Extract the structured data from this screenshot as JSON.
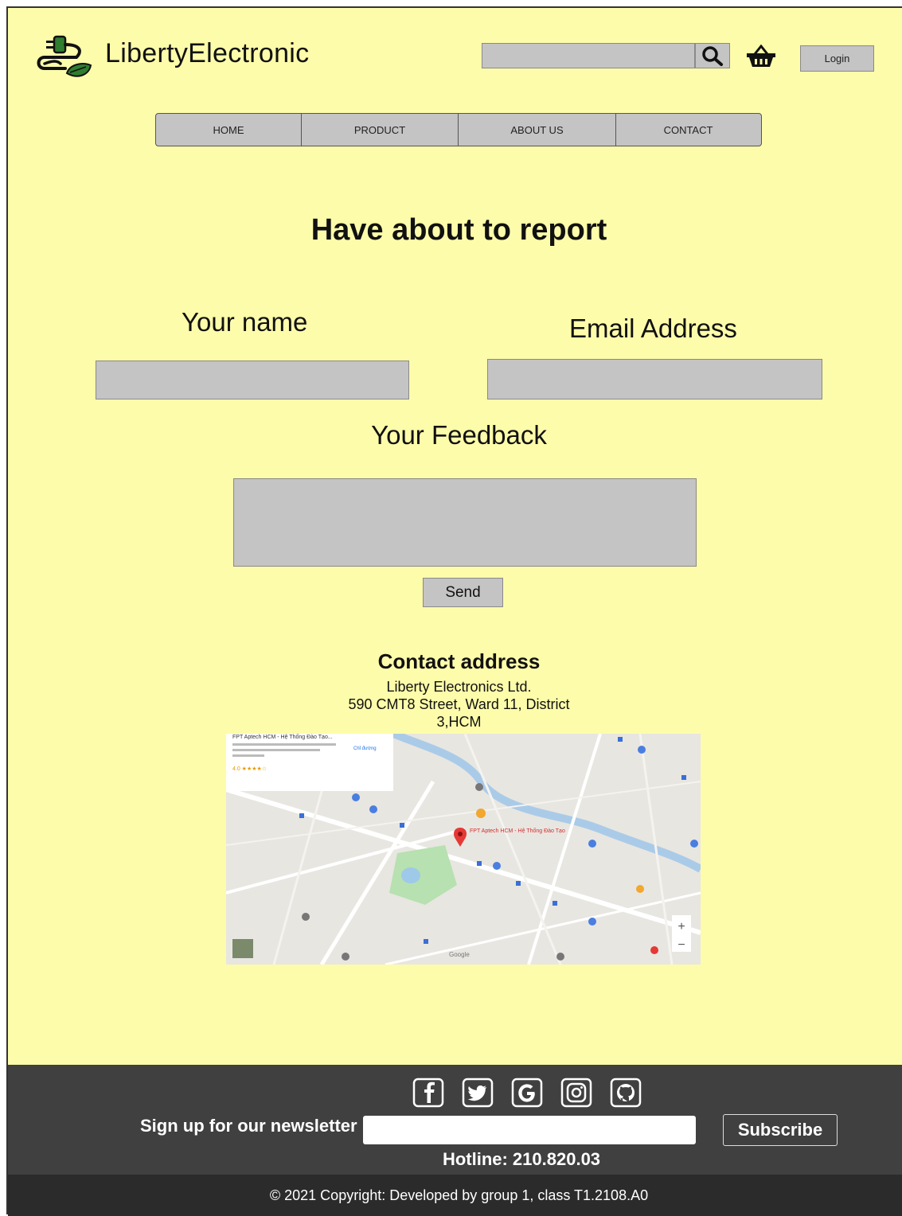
{
  "header": {
    "brand": "LibertyElectronic",
    "login_label": "Login",
    "logo_icon": "plug-leaf-icon",
    "search_icon": "search-icon",
    "cart_icon": "basket-icon"
  },
  "nav": {
    "items": [
      {
        "label": "HOME"
      },
      {
        "label": "PRODUCT"
      },
      {
        "label": "ABOUT US"
      },
      {
        "label": "CONTACT"
      }
    ]
  },
  "form": {
    "heading": "Have about to report",
    "name_label": "Your name",
    "email_label": "Email Address",
    "feedback_label": "Your Feedback",
    "name_value": "",
    "email_value": "",
    "feedback_value": "",
    "send_label": "Send"
  },
  "contact": {
    "title": "Contact address",
    "line1": "Liberty Electronics Ltd.",
    "line2": "590 CMT8 Street, Ward 11, District",
    "line3": "3,HCM"
  },
  "map": {
    "place_name": "FPT Aptech HCM - Hệ Thống Đào Tạo...",
    "pin_label": "FPT Aptech HCM - Hệ Thống Đào Tạo",
    "rating": "4.0 ★★★★☆",
    "directions": "Chỉ đường",
    "zoom_in": "+",
    "zoom_out": "−",
    "provider": "Google"
  },
  "footer": {
    "social_icons": [
      "facebook-icon",
      "twitter-icon",
      "google-icon",
      "instagram-icon",
      "github-icon"
    ],
    "newsletter_label": "Sign up for our newsletter",
    "newsletter_value": "",
    "subscribe_label": "Subscribe",
    "hotline": "Hotline: 210.820.03",
    "copyright": "© 2021 Copyright: Developed by group 1, class T1.2108.A0"
  },
  "colors": {
    "page_bg": "#fdfcaa",
    "field_bg": "#c4c4c4",
    "footer_bg": "#404040",
    "footer_bottom_bg": "#2b2b2b",
    "logo_green": "#2f7d2f"
  }
}
